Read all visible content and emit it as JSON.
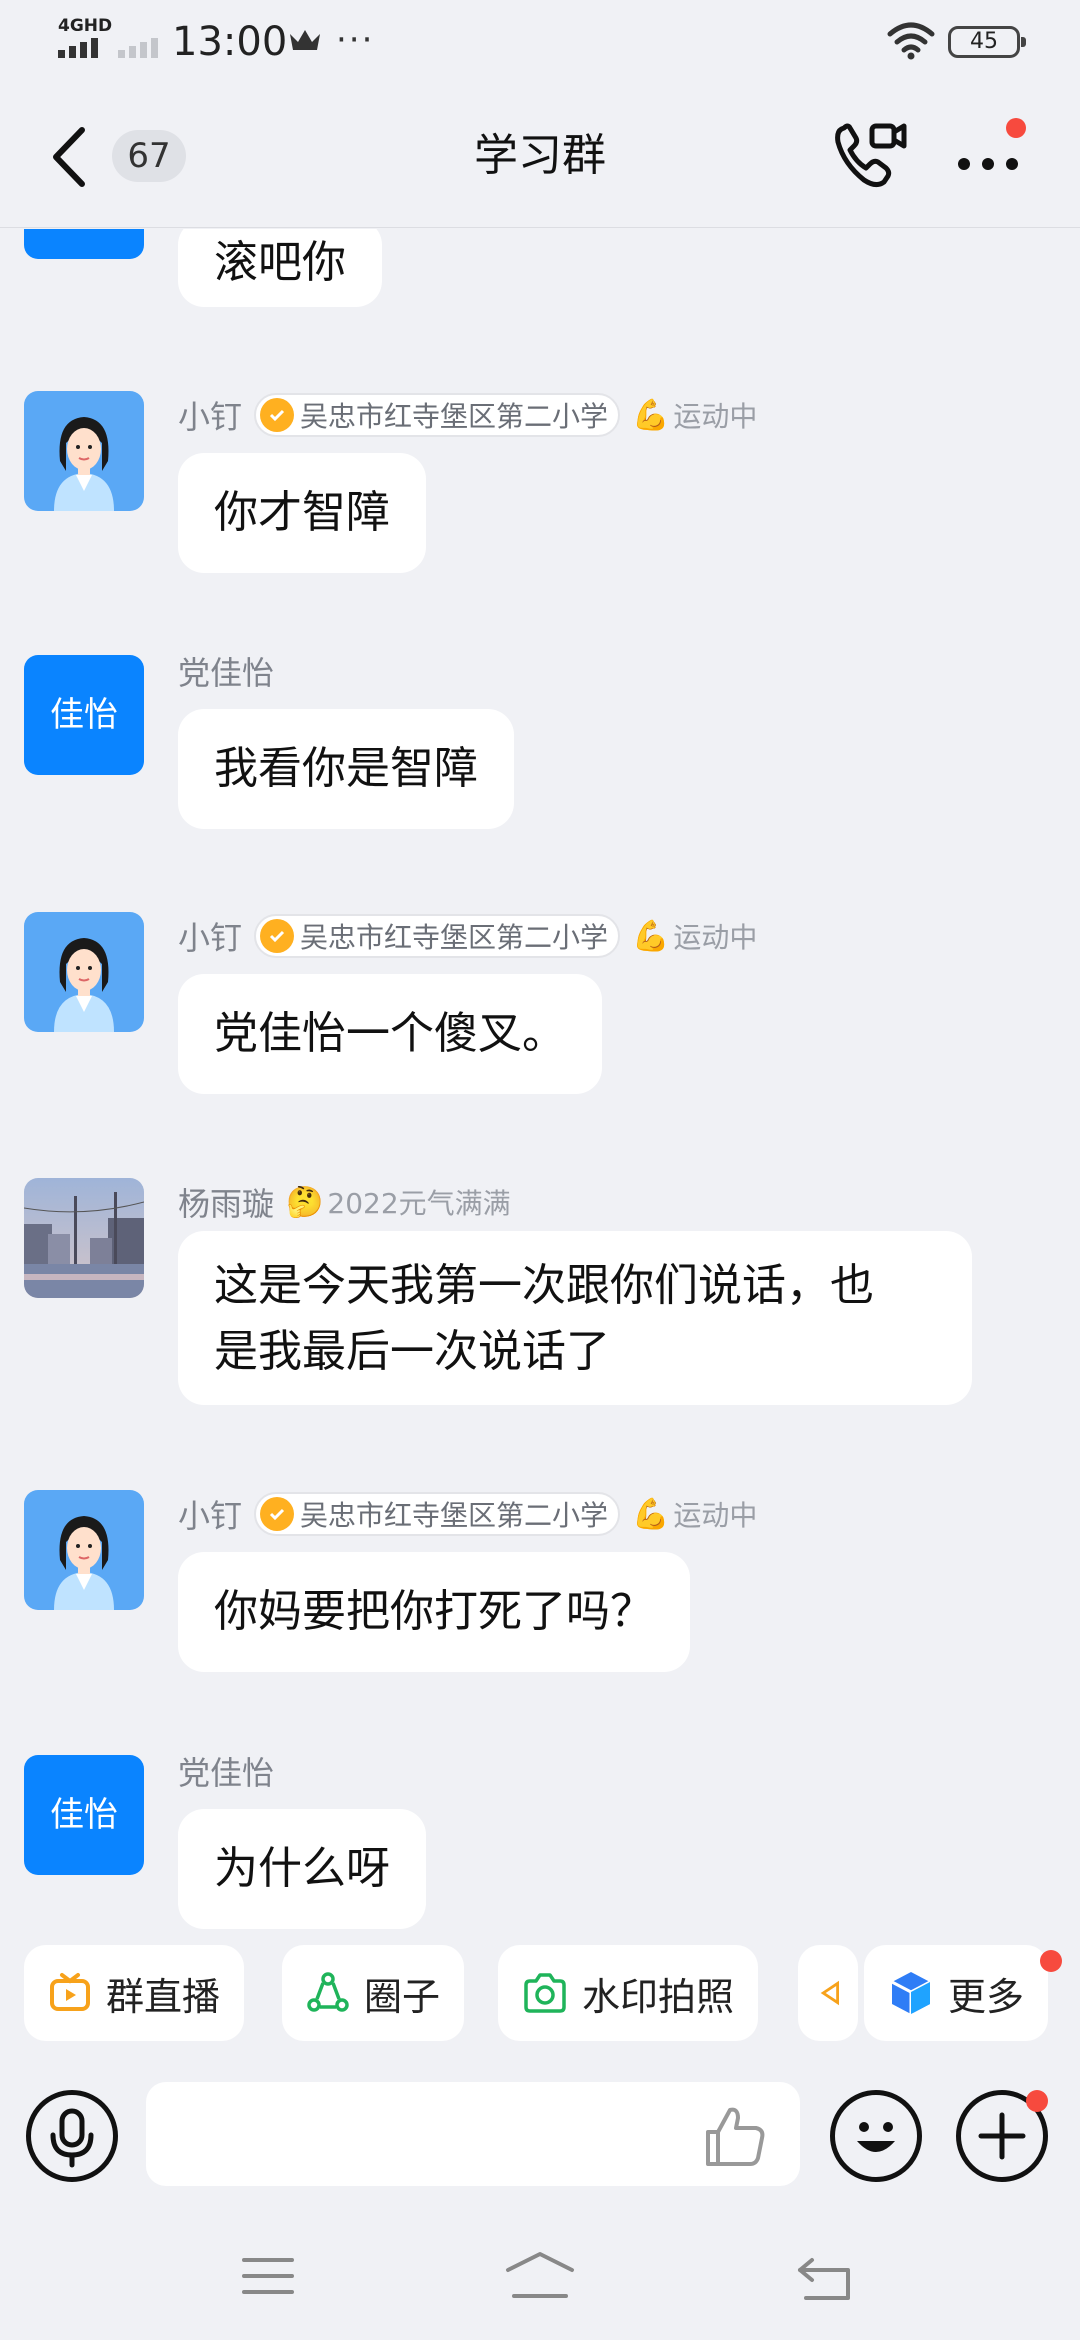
{
  "status_bar": {
    "network": "4GHD",
    "time": "13:00",
    "battery": "45"
  },
  "header": {
    "unread_count": "67",
    "title": "学习群"
  },
  "messages": [
    {
      "sender": "",
      "avatar_text": "",
      "school": "",
      "status": "",
      "text": "滚吧你"
    },
    {
      "sender": "小钉",
      "avatar_text": "",
      "school": "吴忠市红寺堡区第二小学",
      "status": "运动中",
      "text": "你才智障"
    },
    {
      "sender": "党佳怡",
      "avatar_text": "佳怡",
      "school": "",
      "status": "",
      "text": "我看你是智障"
    },
    {
      "sender": "小钉",
      "avatar_text": "",
      "school": "吴忠市红寺堡区第二小学",
      "status": "运动中",
      "text": "党佳怡一个傻叉。"
    },
    {
      "sender": "杨雨璇",
      "avatar_text": "",
      "school": "",
      "status": "2022元气满满",
      "text_line1": "这是今天我第一次跟你们说话，也",
      "text_line2": "是我最后一次说话了"
    },
    {
      "sender": "小钉",
      "avatar_text": "",
      "school": "吴忠市红寺堡区第二小学",
      "status": "运动中",
      "text": "你妈要把你打死了吗？"
    },
    {
      "sender": "党佳怡",
      "avatar_text": "佳怡",
      "school": "",
      "status": "",
      "text": "为什么呀"
    }
  ],
  "quick_actions": [
    {
      "label": "群直播",
      "icon": "live-tv-icon"
    },
    {
      "label": "圈子",
      "icon": "circle-icon"
    },
    {
      "label": "水印拍照",
      "icon": "camera-icon"
    },
    {
      "label": "更多",
      "icon": "cube-icon"
    }
  ],
  "input": {
    "value": "",
    "placeholder": ""
  },
  "colors": {
    "background": "#f0f1f5",
    "accent_blue": "#0a84ff",
    "badge_red": "#f74a3e",
    "verify_orange": "#ffb020"
  }
}
